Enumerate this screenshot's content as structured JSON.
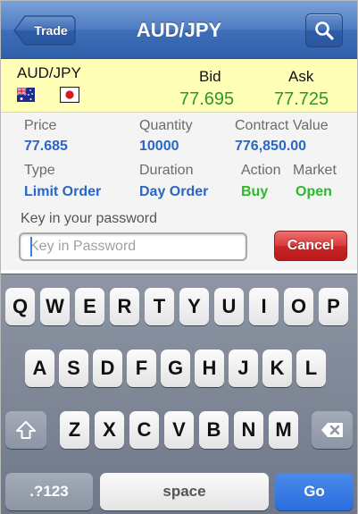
{
  "navbar": {
    "back_label": "Trade",
    "title": "AUD/JPY"
  },
  "quote": {
    "pair": "AUD/JPY",
    "bid_label": "Bid",
    "ask_label": "Ask",
    "bid_value": "77.695",
    "ask_value": "77.725"
  },
  "details": {
    "price_label": "Price",
    "price_value": "77.685",
    "quantity_label": "Quantity",
    "quantity_value": "10000",
    "contract_label": "Contract Value",
    "contract_value": "776,850.00",
    "type_label": "Type",
    "type_value": "Limit Order",
    "duration_label": "Duration",
    "duration_value": "Day Order",
    "action_label": "Action",
    "action_value": "Buy",
    "market_label": "Market",
    "market_value": "Open"
  },
  "password": {
    "prompt": "Key in your password",
    "placeholder": "Key in Password",
    "value": "",
    "cancel_label": "Cancel"
  },
  "keyboard": {
    "row1": [
      "Q",
      "W",
      "E",
      "R",
      "T",
      "Y",
      "U",
      "I",
      "O",
      "P"
    ],
    "row2": [
      "A",
      "S",
      "D",
      "F",
      "G",
      "H",
      "J",
      "K",
      "L"
    ],
    "row3": [
      "Z",
      "X",
      "C",
      "V",
      "B",
      "N",
      "M"
    ],
    "numbers_label": ".?123",
    "space_label": "space",
    "go_label": "Go"
  },
  "colors": {
    "accent_blue": "#2a66c6",
    "positive_green": "#2eb82a",
    "quote_bg": "#ffffb8",
    "cancel_red": "#c92525"
  }
}
